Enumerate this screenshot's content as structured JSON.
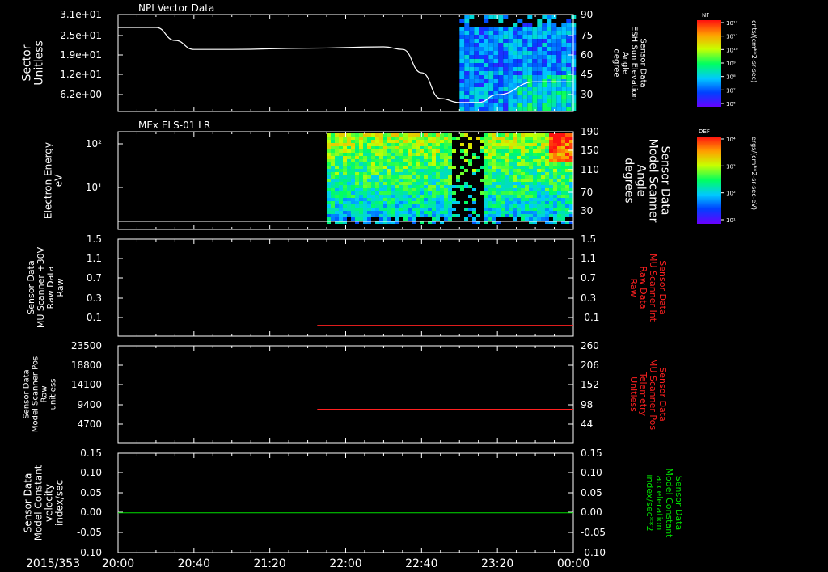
{
  "colors": {
    "background": "#000000",
    "axis": "#ffffff",
    "red_trace": "#ff2020",
    "green_trace": "#00dd00",
    "white_trace": "#ffffff"
  },
  "date_label": "2015/353",
  "chart_data": [
    {
      "type": "line",
      "title": "NPI Vector Data",
      "ylabel": "Sector\nUnitless",
      "yticks": [
        "3.1e+01",
        "2.5e+01",
        "1.9e+01",
        "1.2e+01",
        "6.2e+00"
      ],
      "y2label": "Sensor Data\nESH Sun Elevation\nAngle\ndegree",
      "y2ticks": [
        "90",
        "75",
        "60",
        "45",
        "30"
      ],
      "y2lim": [
        15,
        90
      ],
      "x": [
        "20:00",
        "20:20",
        "20:30",
        "20:40",
        "21:00",
        "21:40",
        "22:20",
        "22:30",
        "22:40",
        "22:50",
        "23:00",
        "23:10",
        "23:20",
        "23:40",
        "00:00"
      ],
      "series": [
        {
          "values": [
            80,
            80,
            70,
            63,
            63,
            64,
            65,
            63,
            45,
            25,
            22,
            22,
            28,
            38,
            38
          ]
        }
      ],
      "spectrogram": {
        "start": "23:00",
        "end": "00:00"
      },
      "colorbar": {
        "title": "NF",
        "ticks": [
          "10¹²",
          "10¹¹",
          "10¹⁰",
          "10⁹",
          "10⁸",
          "10⁷",
          "10⁶"
        ],
        "unit": "cnts/(cm**2-sr-sec)"
      }
    },
    {
      "type": "heatmap",
      "title": "MEx ELS-01 LR",
      "ylabel": "Electron Energy\neV",
      "yticks": [
        "10²",
        "10¹"
      ],
      "y2label": "Sensor Data\nModel Scanner\nAngle\ndegrees",
      "y2ticks": [
        "190",
        "150",
        "110",
        "70",
        "30"
      ],
      "spectrogram": {
        "start": "21:50",
        "end": "00:00"
      },
      "colorbar": {
        "title": "DEF",
        "ticks": [
          "10⁴",
          "10³",
          "10²",
          "10¹"
        ],
        "unit": "ergs/(cm**2-sr-sec-eV)"
      }
    },
    {
      "type": "line",
      "ylabel": "Sensor Data\nMU Scanner +30V\nRaw Data\nRaw",
      "yticks": [
        "1.5",
        "1.1",
        "0.7",
        "0.3",
        "-0.1"
      ],
      "ylim": [
        -0.3,
        1.5
      ],
      "y2label": "Sensor Data\nMU Scanner Int\nRaw Data\nRaw",
      "y2ticks": [
        "1.5",
        "1.1",
        "0.7",
        "0.3",
        "-0.1"
      ],
      "series": [
        {
          "x": [
            "21:45",
            "00:00"
          ],
          "values": [
            -0.1,
            -0.1
          ]
        }
      ]
    },
    {
      "type": "line",
      "ylabel": "Sensor Data\nModel Scanner Pos\nRaw\nunitless",
      "yticks": [
        "23500",
        "18800",
        "14100",
        "9400",
        "4700"
      ],
      "y2label": "Sensor Data\nMU Scanner Pos\nTelemetry\nUnitless",
      "y2ticks": [
        "260",
        "206",
        "152",
        "98",
        "44"
      ],
      "y2lim": [
        0,
        260
      ],
      "series": [
        {
          "x": [
            "21:45",
            "00:00"
          ],
          "values": [
            90,
            90
          ]
        }
      ]
    },
    {
      "type": "line",
      "ylabel": "Sensor Data\nModel Constant\nvelocity\nindex/sec",
      "yticks": [
        "0.15",
        "0.10",
        "0.05",
        "0.00",
        "-0.05",
        "-0.10"
      ],
      "ylim": [
        -0.1,
        0.15
      ],
      "y2label": "Sensor Data\nModel Constant\nacceleration\nindex/sec**2",
      "y2ticks": [
        "0.15",
        "0.10",
        "0.05",
        "0.00",
        "-0.05",
        "-0.10"
      ],
      "series": [
        {
          "x": [
            "20:00",
            "00:00"
          ],
          "values": [
            0.0,
            0.0
          ]
        }
      ]
    }
  ],
  "xaxis": {
    "ticks": [
      "20:00",
      "20:40",
      "21:20",
      "22:00",
      "22:40",
      "23:20",
      "00:00"
    ]
  }
}
